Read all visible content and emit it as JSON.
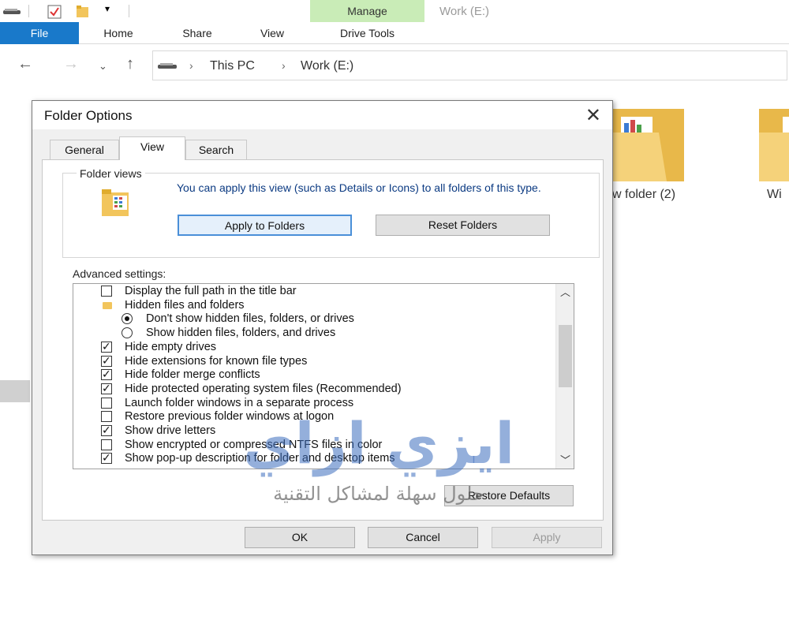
{
  "explorer": {
    "window_title": "Work (E:)",
    "manage_label": "Manage",
    "tabs": [
      "File",
      "Home",
      "Share",
      "View",
      "Drive Tools"
    ],
    "breadcrumb": [
      "This PC",
      "Work (E:)"
    ],
    "folders": [
      {
        "label": "w folder (2)"
      },
      {
        "label": "Wi"
      }
    ]
  },
  "dialog": {
    "title": "Folder Options",
    "tabs": [
      "General",
      "View",
      "Search"
    ],
    "selected_tab": "View",
    "folder_views": {
      "legend": "Folder views",
      "description": "You can apply this view (such as Details or Icons) to all folders of this type.",
      "apply_button": "Apply to Folders",
      "reset_button": "Reset Folders"
    },
    "advanced": {
      "label": "Advanced settings:",
      "items": [
        {
          "kind": "checkbox",
          "checked": false,
          "text": "Display the full path in the title bar"
        },
        {
          "kind": "folder",
          "text": "Hidden files and folders"
        },
        {
          "kind": "radio",
          "checked": true,
          "text": "Don't show hidden files, folders, or drives"
        },
        {
          "kind": "radio",
          "checked": false,
          "text": "Show hidden files, folders, and drives"
        },
        {
          "kind": "checkbox",
          "checked": true,
          "text": "Hide empty drives"
        },
        {
          "kind": "checkbox",
          "checked": true,
          "text": "Hide extensions for known file types"
        },
        {
          "kind": "checkbox",
          "checked": true,
          "text": "Hide folder merge conflicts"
        },
        {
          "kind": "checkbox",
          "checked": true,
          "text": "Hide protected operating system files (Recommended)"
        },
        {
          "kind": "checkbox",
          "checked": false,
          "text": "Launch folder windows in a separate process"
        },
        {
          "kind": "checkbox",
          "checked": false,
          "text": "Restore previous folder windows at logon"
        },
        {
          "kind": "checkbox",
          "checked": true,
          "text": "Show drive letters"
        },
        {
          "kind": "checkbox",
          "checked": false,
          "text": "Show encrypted or compressed NTFS files in color"
        },
        {
          "kind": "checkbox",
          "checked": true,
          "text": "Show pop-up description for folder and desktop items"
        }
      ],
      "restore_button": "Restore Defaults"
    },
    "buttons": {
      "ok": "OK",
      "cancel": "Cancel",
      "apply": "Apply"
    }
  },
  "watermark": {
    "main": "ايزي ازاي",
    "sub": "حلول سهلة لمشاكل التقنية"
  },
  "colors": {
    "file_tab": "#1979ca",
    "manage_tab": "#c9ecb7",
    "folder": "#f2c55c"
  }
}
